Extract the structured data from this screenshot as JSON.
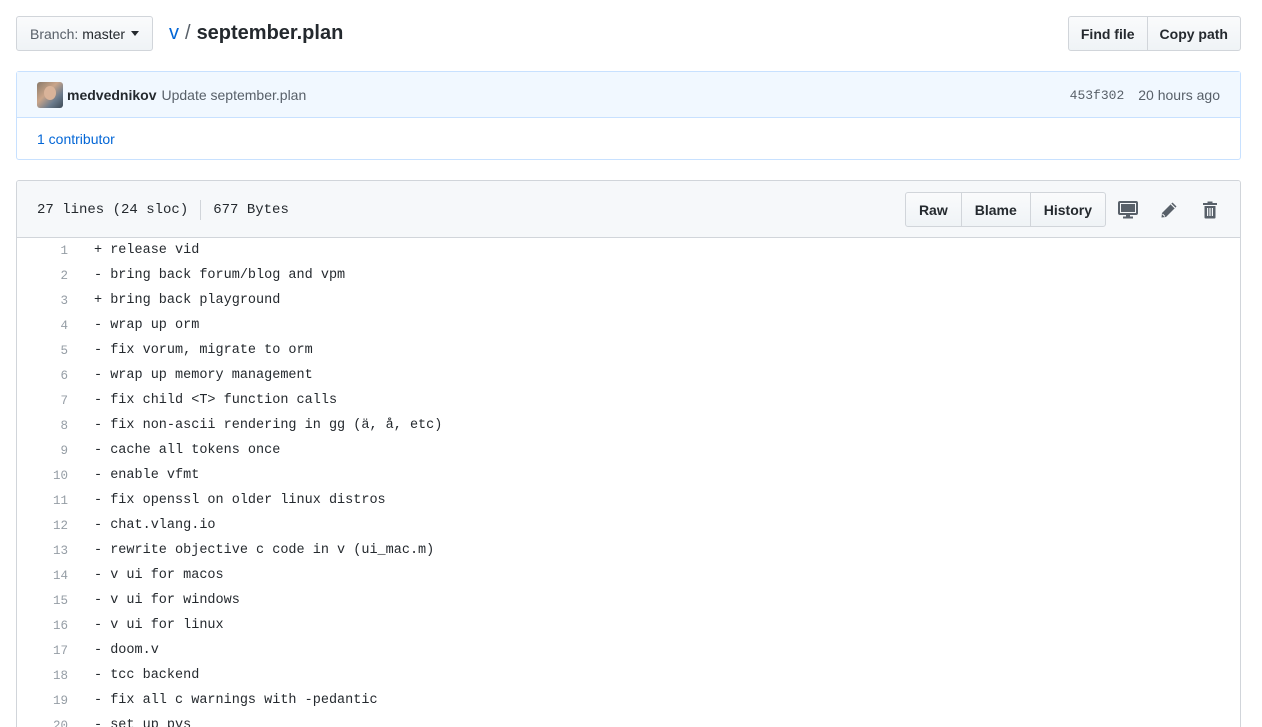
{
  "toolbar": {
    "branch_prefix": "Branch:",
    "branch_name": "master",
    "repo": "v",
    "separator": "/",
    "file_name": "september.plan",
    "find_file": "Find file",
    "copy_path": "Copy path"
  },
  "commit": {
    "author": "medvednikov",
    "message": "Update september.plan",
    "sha": "453f302",
    "time_ago": "20 hours ago",
    "contributors": "1 contributor"
  },
  "file": {
    "lines_info": "27 lines (24 sloc)",
    "size": "677 Bytes",
    "actions": {
      "raw": "Raw",
      "blame": "Blame",
      "history": "History"
    },
    "icons": [
      "desktop-icon",
      "pencil-icon",
      "trash-icon"
    ]
  },
  "lines": [
    {
      "n": "1",
      "text": "+ release vid"
    },
    {
      "n": "2",
      "text": "- bring back forum/blog and vpm"
    },
    {
      "n": "3",
      "text": "+ bring back playground"
    },
    {
      "n": "4",
      "text": "- wrap up orm"
    },
    {
      "n": "5",
      "text": "- fix vorum, migrate to orm"
    },
    {
      "n": "6",
      "text": "- wrap up memory management"
    },
    {
      "n": "7",
      "text": "- fix child <T> function calls"
    },
    {
      "n": "8",
      "text": "- fix non-ascii rendering in gg (ä, å, etc)"
    },
    {
      "n": "9",
      "text": "- cache all tokens once"
    },
    {
      "n": "10",
      "text": "- enable vfmt"
    },
    {
      "n": "11",
      "text": "- fix openssl on older linux distros"
    },
    {
      "n": "12",
      "text": "- chat.vlang.io"
    },
    {
      "n": "13",
      "text": "- rewrite objective c code in v (ui_mac.m)"
    },
    {
      "n": "14",
      "text": "- v ui for macos"
    },
    {
      "n": "15",
      "text": "- v ui for windows"
    },
    {
      "n": "16",
      "text": "- v ui for linux"
    },
    {
      "n": "17",
      "text": "- doom.v"
    },
    {
      "n": "18",
      "text": "- tcc backend"
    },
    {
      "n": "19",
      "text": "- fix all c warnings with -pedantic"
    },
    {
      "n": "20",
      "text": "- set up pvs"
    }
  ]
}
